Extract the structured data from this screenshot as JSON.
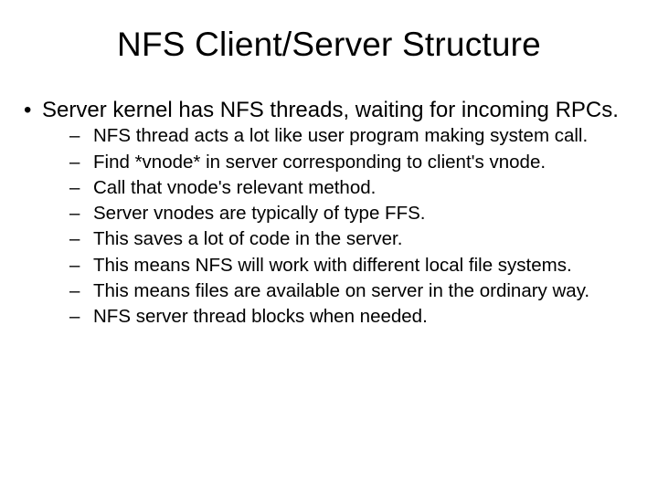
{
  "title": "NFS Client/Server Structure",
  "bullet_main": "Server kernel has NFS threads, waiting for incoming RPCs.",
  "sub_bullets": [
    "NFS thread acts a lot like user program making system call.",
    "Find *vnode* in server corresponding to client's vnode.",
    "Call that vnode's relevant method.",
    "Server vnodes are typically of type FFS.",
    "This saves a lot of code in the server.",
    "This means NFS will work with different local file systems.",
    "This means files are available on server in the ordinary way.",
    "NFS server thread blocks when needed."
  ]
}
